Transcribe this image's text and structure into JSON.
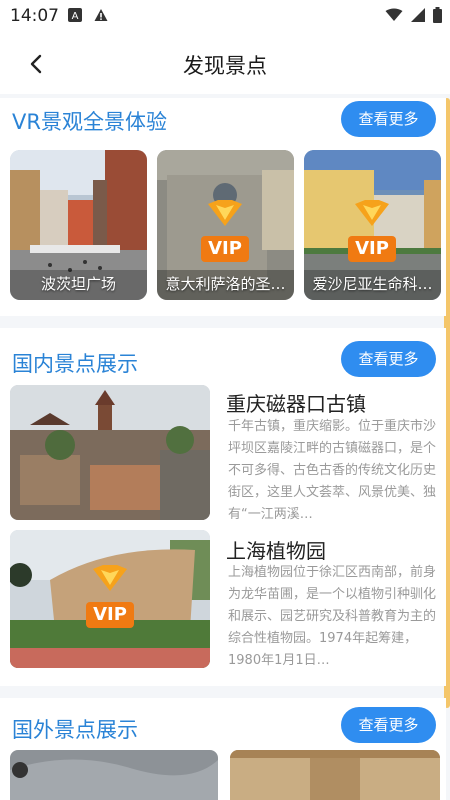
{
  "status": {
    "time": "14:07"
  },
  "header": {
    "title": "发现景点"
  },
  "vr": {
    "title": "VR景观全景体验",
    "more": "查看更多",
    "items": [
      {
        "caption": "波茨坦广场"
      },
      {
        "caption": "意大利萨洛的圣…",
        "badge": "VIP"
      },
      {
        "caption": "爱沙尼亚生命科…",
        "badge": "VIP"
      }
    ]
  },
  "domestic": {
    "title": "国内景点展示",
    "more": "查看更多",
    "items": [
      {
        "name": "重庆磁器口古镇",
        "desc": "千年古镇，重庆缩影。位于重庆市沙坪坝区嘉陵江畔的古镇磁器口，是个不可多得、古色古香的传统文化历史街区，这里人文荟萃、风景优美、独有“一江两溪…"
      },
      {
        "name": "上海植物园",
        "desc": "上海植物园位于徐汇区西南部，前身为龙华苗圃，是一个以植物引种驯化和展示、园艺研究及科普教育为主的综合性植物园。1974年起筹建，1980年1月1日…",
        "badge": "VIP"
      }
    ]
  },
  "abroad": {
    "title": "国外景点展示",
    "more": "查看更多"
  }
}
